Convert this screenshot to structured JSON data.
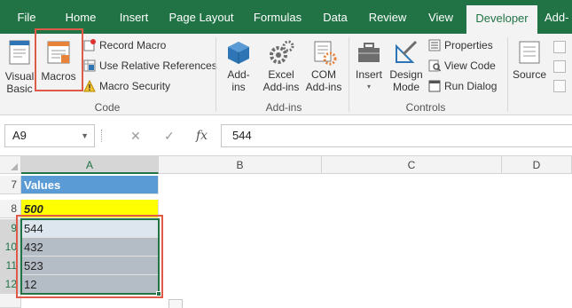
{
  "tabs": [
    {
      "label": "File",
      "active": false
    },
    {
      "label": "Home",
      "active": false
    },
    {
      "label": "Insert",
      "active": false
    },
    {
      "label": "Page Layout",
      "active": false
    },
    {
      "label": "Formulas",
      "active": false
    },
    {
      "label": "Data",
      "active": false
    },
    {
      "label": "Review",
      "active": false
    },
    {
      "label": "View",
      "active": false
    },
    {
      "label": "Developer",
      "active": true
    },
    {
      "label": "Add-",
      "active": false
    }
  ],
  "ribbon": {
    "code": {
      "visual_basic_line1": "Visual",
      "visual_basic_line2": "Basic",
      "macros": "Macros",
      "record_macro": "Record Macro",
      "use_relative_references": "Use Relative References",
      "macro_security": "Macro Security",
      "group_label": "Code"
    },
    "addins": {
      "addins_line1": "Add-",
      "addins_line2": "ins",
      "excel_addins_line1": "Excel",
      "excel_addins_line2": "Add-ins",
      "com_addins_line1": "COM",
      "com_addins_line2": "Add-ins",
      "group_label": "Add-ins"
    },
    "controls": {
      "insert": "Insert",
      "design_mode_line1": "Design",
      "design_mode_line2": "Mode",
      "properties": "Properties",
      "view_code": "View Code",
      "run_dialog": "Run Dialog",
      "group_label": "Controls"
    },
    "xml": {
      "source": "Source"
    }
  },
  "formula_bar": {
    "name_box": "A9",
    "cancel_symbol": "✕",
    "enter_symbol": "✓",
    "fx_symbol": "fx",
    "value": "544"
  },
  "sheet": {
    "columns": [
      "A",
      "B",
      "C",
      "D"
    ],
    "rows": [
      {
        "num": "7",
        "a": "Values"
      },
      {
        "num": "8",
        "a": "500"
      },
      {
        "num": "9",
        "a": "544"
      },
      {
        "num": "10",
        "a": "432"
      },
      {
        "num": "11",
        "a": "523"
      },
      {
        "num": "12",
        "a": "12"
      }
    ]
  },
  "colors": {
    "brand_green": "#217346",
    "header_blue": "#5b9bd5",
    "highlight_yellow": "#ffff00",
    "callout_red": "#e05a4a"
  },
  "icons": [
    "visual-basic-icon",
    "macros-icon",
    "record-macro-icon",
    "relative-references-icon",
    "macro-security-warning-icon",
    "addins-cube-icon",
    "excel-addins-gear-icon",
    "com-addins-icon",
    "insert-toolbox-icon",
    "design-mode-icon",
    "properties-icon",
    "view-code-icon",
    "run-dialog-icon",
    "source-icon"
  ]
}
